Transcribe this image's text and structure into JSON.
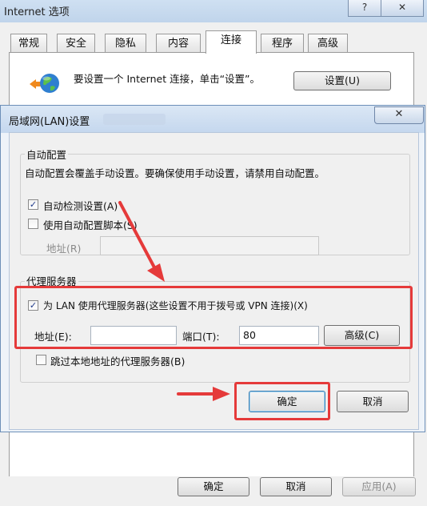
{
  "outer_window": {
    "title": "Internet 选项",
    "caption_buttons": [
      "?",
      "✕"
    ],
    "tabs": [
      "常规",
      "安全",
      "隐私",
      "内容",
      "连接",
      "程序",
      "高级"
    ],
    "active_tab": "连接",
    "setup_text": "要设置一个 Internet 连接，单击“设置”。",
    "setup_button": "设置(U)",
    "ok_button": "确定",
    "cancel_button": "取消",
    "apply_button": "应用(A)"
  },
  "lan_dialog": {
    "title": "局域网(LAN)设置",
    "close_button": "✕",
    "auto_config": {
      "heading": "自动配置",
      "description": "自动配置会覆盖手动设置。要确保使用手动设置，请禁用自动配置。",
      "auto_detect_label": "自动检测设置(A)",
      "auto_detect_checked": "✓",
      "use_script_label": "使用自动配置脚本(S)",
      "address_label": "地址(R)",
      "address_value": ""
    },
    "proxy": {
      "heading": "代理服务器",
      "use_proxy_label": "为 LAN 使用代理服务器(这些设置不用于拨号或 VPN 连接)(X)",
      "use_proxy_checked": "✓",
      "address_label": "地址(E):",
      "address_value": "",
      "port_label": "端口(T):",
      "port_value": "80",
      "advanced_button": "高级(C)",
      "bypass_label": "跳过本地地址的代理服务器(B)"
    },
    "ok_button": "确定",
    "cancel_button": "取消"
  },
  "colors": {
    "annotation_red": "#e53a3a",
    "titlebar_blue": "#c4d7ee"
  }
}
